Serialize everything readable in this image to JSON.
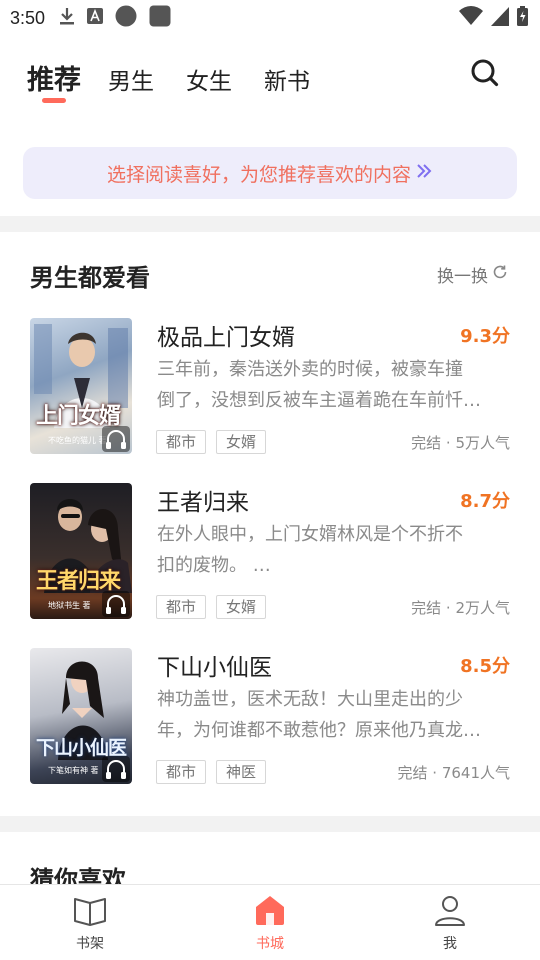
{
  "status_bar": {
    "time": "3:50"
  },
  "top_tabs": [
    {
      "label": "推荐",
      "active": true
    },
    {
      "label": "男生",
      "active": false
    },
    {
      "label": "女生",
      "active": false
    },
    {
      "label": "新书",
      "active": false
    }
  ],
  "banner": {
    "text": "选择阅读喜好，为您推荐喜欢的内容"
  },
  "section": {
    "title": "男生都爱看",
    "refresh_label": "换一换",
    "books": [
      {
        "title": "极品上门女婿",
        "score": "9.3分",
        "desc_line1": "三年前，秦浩送外卖的时候，被豪车撞",
        "desc_line2": "倒了，没想到反被车主逼着跪在车前忏…",
        "tags": [
          "都市",
          "女婿"
        ],
        "meta": "完结 · 5万人气",
        "cover_text": "上门女婿",
        "cover_author": "不吃鱼的猫儿 著"
      },
      {
        "title": "王者归来",
        "score": "8.7分",
        "desc_line1": "在外人眼中，上门女婿林风是个不折不",
        "desc_line2": "扣的废物。 …",
        "tags": [
          "都市",
          "女婿"
        ],
        "meta": "完结 · 2万人气",
        "cover_text": "王者归来",
        "cover_author": "地狱书生 著"
      },
      {
        "title": "下山小仙医",
        "score": "8.5分",
        "desc_line1": "神功盖世，医术无敌！大山里走出的少",
        "desc_line2": "年，为何谁都不敢惹他？原来他乃真龙…",
        "tags": [
          "都市",
          "神医"
        ],
        "meta": "完结 · 7641人气",
        "cover_text": "下山小仙医",
        "cover_author": "下笔如有神 著"
      }
    ]
  },
  "guess_section": {
    "title": "猜你喜欢"
  },
  "bottom_nav": [
    {
      "label": "书架",
      "icon": "book-open-icon",
      "active": false
    },
    {
      "label": "书城",
      "icon": "home-icon",
      "active": true
    },
    {
      "label": "我",
      "icon": "user-icon",
      "active": false
    }
  ],
  "colors": {
    "accent": "#ff6a5b",
    "score": "#f07323",
    "banner_bg": "#eeedfb",
    "banner_text": "#f0705f"
  }
}
